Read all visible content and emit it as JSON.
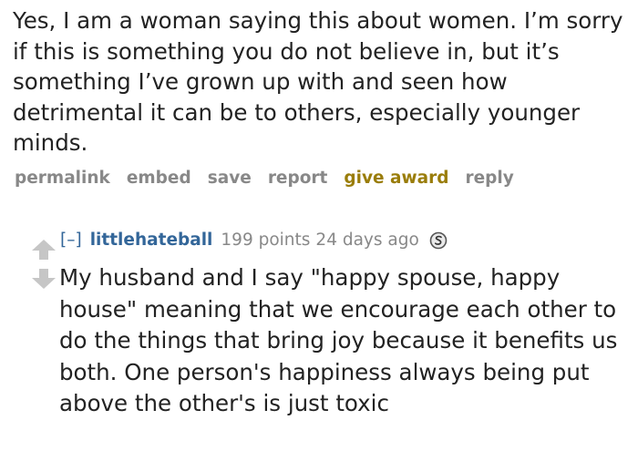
{
  "parent_comment": {
    "body": "Yes, I am a woman saying this about women. I’m sorry if this is something you do not believe in, but it’s something I’ve grown up with and seen how detrimental it can be to others, especially younger minds.",
    "buttons": {
      "permalink": "permalink",
      "embed": "embed",
      "save": "save",
      "report": "report",
      "give_award": "give award",
      "reply": "reply"
    }
  },
  "child_comment": {
    "toggle": "[–]",
    "author": "littlehateball",
    "score": "199 points",
    "time": "24 days ago",
    "badge_icon": "silver-award-icon",
    "upvote_icon": "upvote-arrow-icon",
    "downvote_icon": "downvote-arrow-icon",
    "body": "My husband and I say \"happy spouse, happy house\" meaning that we encourage each other to do the things that bring joy because it benefits us both. One person's happiness always being put above the other's is just toxic"
  },
  "colors": {
    "text": "#222222",
    "muted": "#888888",
    "link": "#336699",
    "award": "#9a7d0a"
  }
}
